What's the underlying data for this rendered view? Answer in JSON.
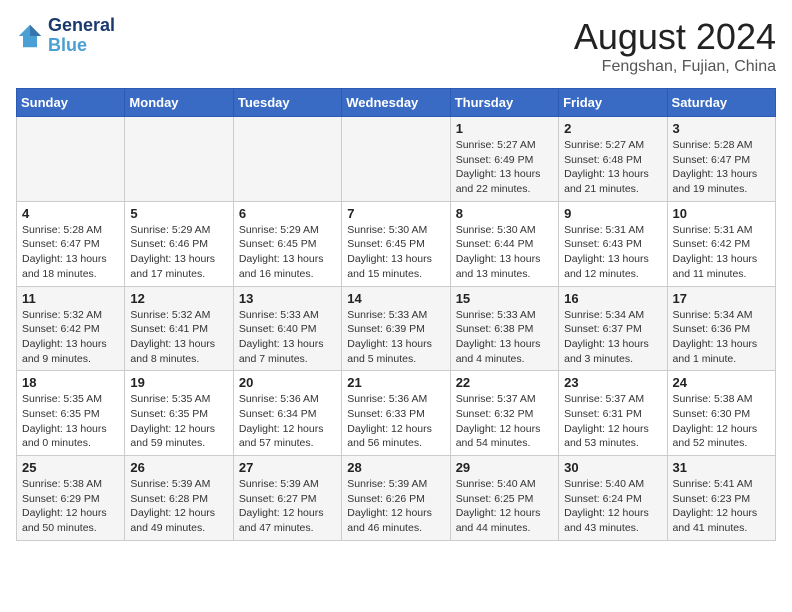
{
  "header": {
    "logo_line1": "General",
    "logo_line2": "Blue",
    "title": "August 2024",
    "location": "Fengshan, Fujian, China"
  },
  "weekdays": [
    "Sunday",
    "Monday",
    "Tuesday",
    "Wednesday",
    "Thursday",
    "Friday",
    "Saturday"
  ],
  "weeks": [
    [
      {
        "day": "",
        "info": ""
      },
      {
        "day": "",
        "info": ""
      },
      {
        "day": "",
        "info": ""
      },
      {
        "day": "",
        "info": ""
      },
      {
        "day": "1",
        "info": "Sunrise: 5:27 AM\nSunset: 6:49 PM\nDaylight: 13 hours\nand 22 minutes."
      },
      {
        "day": "2",
        "info": "Sunrise: 5:27 AM\nSunset: 6:48 PM\nDaylight: 13 hours\nand 21 minutes."
      },
      {
        "day": "3",
        "info": "Sunrise: 5:28 AM\nSunset: 6:47 PM\nDaylight: 13 hours\nand 19 minutes."
      }
    ],
    [
      {
        "day": "4",
        "info": "Sunrise: 5:28 AM\nSunset: 6:47 PM\nDaylight: 13 hours\nand 18 minutes."
      },
      {
        "day": "5",
        "info": "Sunrise: 5:29 AM\nSunset: 6:46 PM\nDaylight: 13 hours\nand 17 minutes."
      },
      {
        "day": "6",
        "info": "Sunrise: 5:29 AM\nSunset: 6:45 PM\nDaylight: 13 hours\nand 16 minutes."
      },
      {
        "day": "7",
        "info": "Sunrise: 5:30 AM\nSunset: 6:45 PM\nDaylight: 13 hours\nand 15 minutes."
      },
      {
        "day": "8",
        "info": "Sunrise: 5:30 AM\nSunset: 6:44 PM\nDaylight: 13 hours\nand 13 minutes."
      },
      {
        "day": "9",
        "info": "Sunrise: 5:31 AM\nSunset: 6:43 PM\nDaylight: 13 hours\nand 12 minutes."
      },
      {
        "day": "10",
        "info": "Sunrise: 5:31 AM\nSunset: 6:42 PM\nDaylight: 13 hours\nand 11 minutes."
      }
    ],
    [
      {
        "day": "11",
        "info": "Sunrise: 5:32 AM\nSunset: 6:42 PM\nDaylight: 13 hours\nand 9 minutes."
      },
      {
        "day": "12",
        "info": "Sunrise: 5:32 AM\nSunset: 6:41 PM\nDaylight: 13 hours\nand 8 minutes."
      },
      {
        "day": "13",
        "info": "Sunrise: 5:33 AM\nSunset: 6:40 PM\nDaylight: 13 hours\nand 7 minutes."
      },
      {
        "day": "14",
        "info": "Sunrise: 5:33 AM\nSunset: 6:39 PM\nDaylight: 13 hours\nand 5 minutes."
      },
      {
        "day": "15",
        "info": "Sunrise: 5:33 AM\nSunset: 6:38 PM\nDaylight: 13 hours\nand 4 minutes."
      },
      {
        "day": "16",
        "info": "Sunrise: 5:34 AM\nSunset: 6:37 PM\nDaylight: 13 hours\nand 3 minutes."
      },
      {
        "day": "17",
        "info": "Sunrise: 5:34 AM\nSunset: 6:36 PM\nDaylight: 13 hours\nand 1 minute."
      }
    ],
    [
      {
        "day": "18",
        "info": "Sunrise: 5:35 AM\nSunset: 6:35 PM\nDaylight: 13 hours\nand 0 minutes."
      },
      {
        "day": "19",
        "info": "Sunrise: 5:35 AM\nSunset: 6:35 PM\nDaylight: 12 hours\nand 59 minutes."
      },
      {
        "day": "20",
        "info": "Sunrise: 5:36 AM\nSunset: 6:34 PM\nDaylight: 12 hours\nand 57 minutes."
      },
      {
        "day": "21",
        "info": "Sunrise: 5:36 AM\nSunset: 6:33 PM\nDaylight: 12 hours\nand 56 minutes."
      },
      {
        "day": "22",
        "info": "Sunrise: 5:37 AM\nSunset: 6:32 PM\nDaylight: 12 hours\nand 54 minutes."
      },
      {
        "day": "23",
        "info": "Sunrise: 5:37 AM\nSunset: 6:31 PM\nDaylight: 12 hours\nand 53 minutes."
      },
      {
        "day": "24",
        "info": "Sunrise: 5:38 AM\nSunset: 6:30 PM\nDaylight: 12 hours\nand 52 minutes."
      }
    ],
    [
      {
        "day": "25",
        "info": "Sunrise: 5:38 AM\nSunset: 6:29 PM\nDaylight: 12 hours\nand 50 minutes."
      },
      {
        "day": "26",
        "info": "Sunrise: 5:39 AM\nSunset: 6:28 PM\nDaylight: 12 hours\nand 49 minutes."
      },
      {
        "day": "27",
        "info": "Sunrise: 5:39 AM\nSunset: 6:27 PM\nDaylight: 12 hours\nand 47 minutes."
      },
      {
        "day": "28",
        "info": "Sunrise: 5:39 AM\nSunset: 6:26 PM\nDaylight: 12 hours\nand 46 minutes."
      },
      {
        "day": "29",
        "info": "Sunrise: 5:40 AM\nSunset: 6:25 PM\nDaylight: 12 hours\nand 44 minutes."
      },
      {
        "day": "30",
        "info": "Sunrise: 5:40 AM\nSunset: 6:24 PM\nDaylight: 12 hours\nand 43 minutes."
      },
      {
        "day": "31",
        "info": "Sunrise: 5:41 AM\nSunset: 6:23 PM\nDaylight: 12 hours\nand 41 minutes."
      }
    ]
  ]
}
